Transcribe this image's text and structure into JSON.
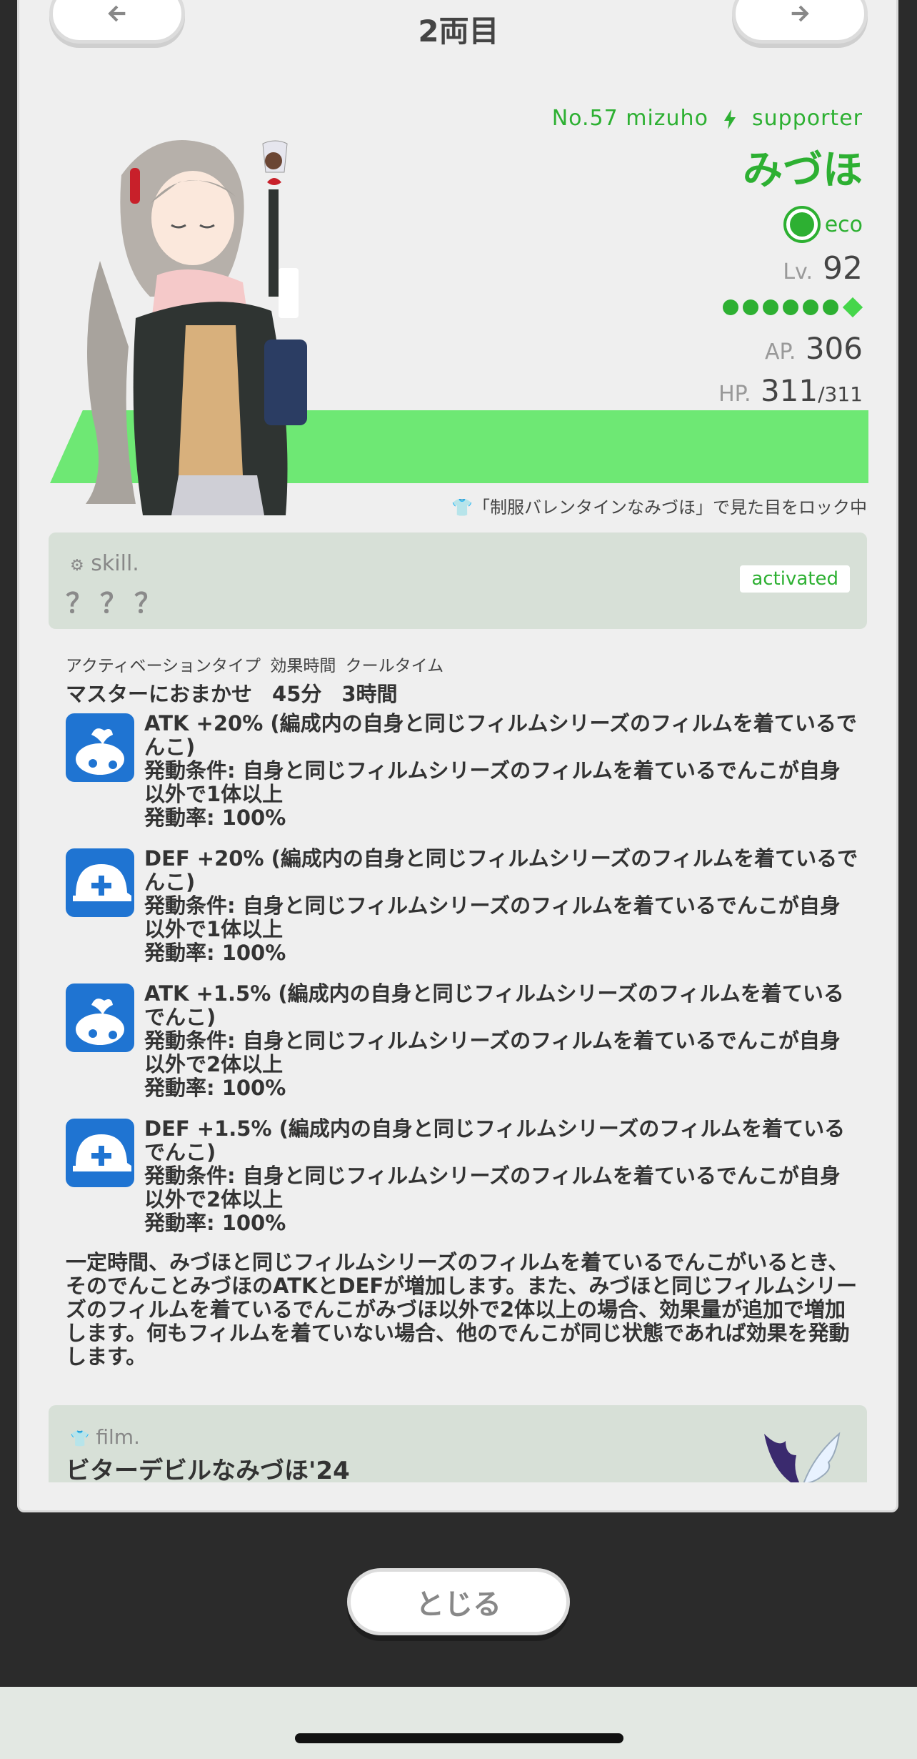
{
  "header": {
    "title": "2両目",
    "prev_icon": "arrow-left-icon",
    "next_icon": "arrow-right-icon"
  },
  "character": {
    "number_line": "No.57 mizuho",
    "type_icon": "lightning-icon",
    "role": "supporter",
    "name": "みづほ",
    "element_icon": "eco-leaf-icon",
    "element": "eco",
    "lv_label": "Lv.",
    "lv": "92",
    "rank_dots_filled": 6,
    "ap_label": "AP.",
    "ap": "306",
    "hp_label": "HP.",
    "hp": "311",
    "hp_max": "/311",
    "lock_note": "「制服バレンタインなみづほ」で見た目をロック中",
    "accent_color": "#2db032",
    "band_color": "#6ee874"
  },
  "skill": {
    "label": "skill.",
    "name": "？？？",
    "status": "activated",
    "headers": "アクティベーションタイプ 効果時間 クールタイム",
    "activation_type": "マスターにおまかせ",
    "duration": "45分",
    "cooldown": "3時間",
    "effects": [
      {
        "icon": "atk-character-icon",
        "text": "ATK +20% (編成内の自身と同じフィルムシリーズのフィルムを着ているでんこ)\n発動条件: 自身と同じフィルムシリーズのフィルムを着ているでんこが自身以外で1体以上\n発動率: 100%"
      },
      {
        "icon": "def-helmet-icon",
        "text": "DEF +20% (編成内の自身と同じフィルムシリーズのフィルムを着ているでんこ)\n発動条件: 自身と同じフィルムシリーズのフィルムを着ているでんこが自身以外で1体以上\n発動率: 100%"
      },
      {
        "icon": "atk-character-icon",
        "text": "ATK +1.5% (編成内の自身と同じフィルムシリーズのフィルムを着ているでんこ)\n発動条件: 自身と同じフィルムシリーズのフィルムを着ているでんこが自身以外で2体以上\n発動率: 100%"
      },
      {
        "icon": "def-helmet-icon",
        "text": "DEF +1.5% (編成内の自身と同じフィルムシリーズのフィルムを着ているでんこ)\n発動条件: 自身と同じフィルムシリーズのフィルムを着ているでんこが自身以外で2体以上\n発動率: 100%"
      }
    ],
    "description": "一定時間、みづほと同じフィルムシリーズのフィルムを着ているでんこがいるとき、そのでんことみづほのATKとDEFが増加します。また、みづほと同じフィルムシリーズのフィルムを着ているでんこがみづほ以外で2体以上の場合、効果量が追加で増加します。何もフィルムを着ていない場合、他のでんこが同じ状態であれば効果を発動します。"
  },
  "film": {
    "label": "film.",
    "name": "ビターデビルなみづほ'24",
    "icon": "wings-icon"
  },
  "footer": {
    "close_label": "とじる"
  }
}
